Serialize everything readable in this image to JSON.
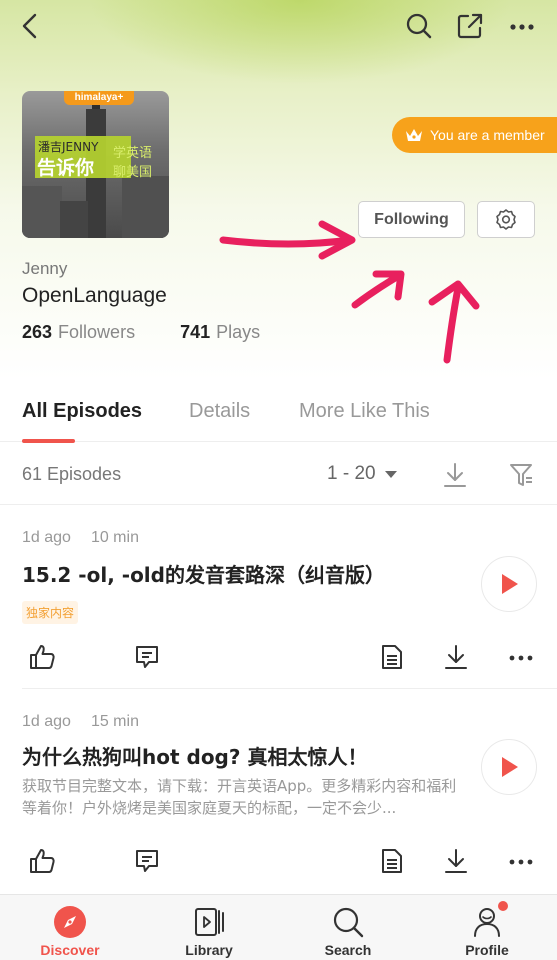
{
  "header": {
    "back_icon": "chevron-left-icon",
    "search_icon": "search-icon",
    "share_icon": "share-icon",
    "more_icon": "more-horizontal-icon"
  },
  "cover": {
    "brand": "himalaya+",
    "text_line1": "潘吉JENNY",
    "text_line2": "告诉你",
    "text_side1": "学英语",
    "text_side2": "聊美国"
  },
  "member_badge": {
    "label": "You are a member",
    "icon": "crown-icon"
  },
  "following_button": {
    "label": "Following"
  },
  "settings_button": {
    "icon": "gear-icon"
  },
  "channel": {
    "author": "Jenny",
    "name": "OpenLanguage",
    "followers_count": "263",
    "followers_label": "Followers",
    "plays_count": "741",
    "plays_label": "Plays"
  },
  "tabs": [
    {
      "label": "All Episodes",
      "active": true
    },
    {
      "label": "Details",
      "active": false
    },
    {
      "label": "More Like This",
      "active": false
    }
  ],
  "list_header": {
    "count": "61 Episodes",
    "range": "1 - 20",
    "download_icon": "download-icon",
    "filter_icon": "filter-icon"
  },
  "episodes": [
    {
      "age": "1d ago",
      "duration": "10 min",
      "title": "15.2 -ol, -old的发音套路深（纠音版）",
      "tag": "独家内容",
      "description": ""
    },
    {
      "age": "1d ago",
      "duration": "15 min",
      "title": "为什么热狗叫hot dog? 真相太惊人！",
      "tag": "",
      "description": "获取节目完整文本，请下载：开言英语App。更多精彩内容和福利等着你！户外烧烤是美国家庭夏天的标配，一定不会少..."
    }
  ],
  "bottom_nav": [
    {
      "label": "Discover",
      "icon": "compass-icon",
      "active": true
    },
    {
      "label": "Library",
      "icon": "library-icon",
      "active": false
    },
    {
      "label": "Search",
      "icon": "search-icon",
      "active": false
    },
    {
      "label": "Profile",
      "icon": "profile-icon",
      "active": false,
      "badge": true
    }
  ],
  "colors": {
    "accent": "#f0544c",
    "member_badge": "#f7a21b",
    "annotation": "#e8205e"
  }
}
